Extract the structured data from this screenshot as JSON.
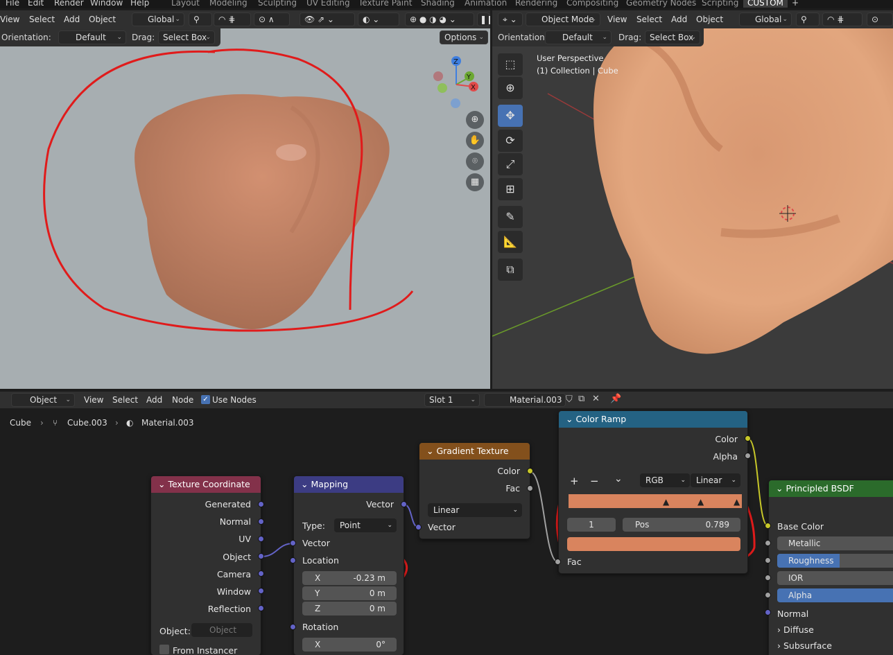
{
  "topbar": {
    "menus": [
      "File",
      "Edit",
      "Render",
      "Window",
      "Help"
    ],
    "workspaces": [
      "Layout",
      "Modeling",
      "Sculpting",
      "UV Editing",
      "Texture Paint",
      "Shading",
      "Animation",
      "Rendering",
      "Compositing",
      "Geometry Nodes",
      "Scripting",
      "CUSTOM"
    ],
    "add_tab": "+"
  },
  "left_viewport": {
    "menus": [
      "View",
      "Select",
      "Add",
      "Object"
    ],
    "transform": "Global",
    "orientation_label": "Orientation:",
    "orientation_value": "Default",
    "drag_label": "Drag:",
    "drag_value": "Select Box",
    "options": "Options",
    "gizmo": {
      "x": "X",
      "y": "Y",
      "z": "Z"
    },
    "object_color": "#c27f62",
    "annotation_color": "#e01b1b"
  },
  "right_viewport": {
    "mode": "Object Mode",
    "menus": [
      "View",
      "Select",
      "Add",
      "Object"
    ],
    "transform": "Global",
    "orientation_label": "Orientation:",
    "orientation_value": "Default",
    "drag_label": "Drag:",
    "drag_value": "Select Box",
    "perspective": "User Perspective",
    "collection": "(1) Collection | Cube"
  },
  "node_editor": {
    "editor_type": "Object",
    "menus": [
      "View",
      "Select",
      "Add",
      "Node"
    ],
    "use_nodes": "Use Nodes",
    "slot": "Slot 1",
    "material": "Material.003",
    "breadcrumb": [
      "Cube",
      "Cube.003",
      "Material.003"
    ]
  },
  "nodes": {
    "texcoord": {
      "title": "Texture Coordinate",
      "outputs": [
        "Generated",
        "Normal",
        "UV",
        "Object",
        "Camera",
        "Window",
        "Reflection"
      ],
      "object_label": "Object:",
      "object_placeholder": "Object",
      "from_instancer": "From Instancer"
    },
    "mapping": {
      "title": "Mapping",
      "output": "Vector",
      "type_label": "Type:",
      "type_value": "Point",
      "vector_in": "Vector",
      "location": "Location",
      "loc_x_label": "X",
      "loc_x": "-0.23 m",
      "loc_y_label": "Y",
      "loc_y": "0 m",
      "loc_z_label": "Z",
      "loc_z": "0 m",
      "rotation": "Rotation",
      "rot_x_label": "X",
      "rot_x": "0°"
    },
    "gradient": {
      "title": "Gradient Texture",
      "out_color": "Color",
      "out_fac": "Fac",
      "type": "Linear",
      "vector_in": "Vector"
    },
    "colorramp": {
      "title": "Color Ramp",
      "out_color": "Color",
      "out_alpha": "Alpha",
      "add": "+",
      "remove": "−",
      "more": "⌄",
      "mode": "RGB",
      "interp": "Linear",
      "index": "1",
      "pos_label": "Pos",
      "pos_value": "0.789",
      "fac_in": "Fac",
      "ramp_color": "#d9845e"
    },
    "bsdf": {
      "title": "Principled BSDF",
      "base_color": "Base Color",
      "metallic": "Metallic",
      "roughness": "Roughness",
      "roughness_level": 0.5,
      "ior": "IOR",
      "alpha": "Alpha",
      "alpha_level": 1.0,
      "normal": "Normal",
      "diffuse": "Diffuse",
      "subsurface": "Subsurface"
    }
  }
}
